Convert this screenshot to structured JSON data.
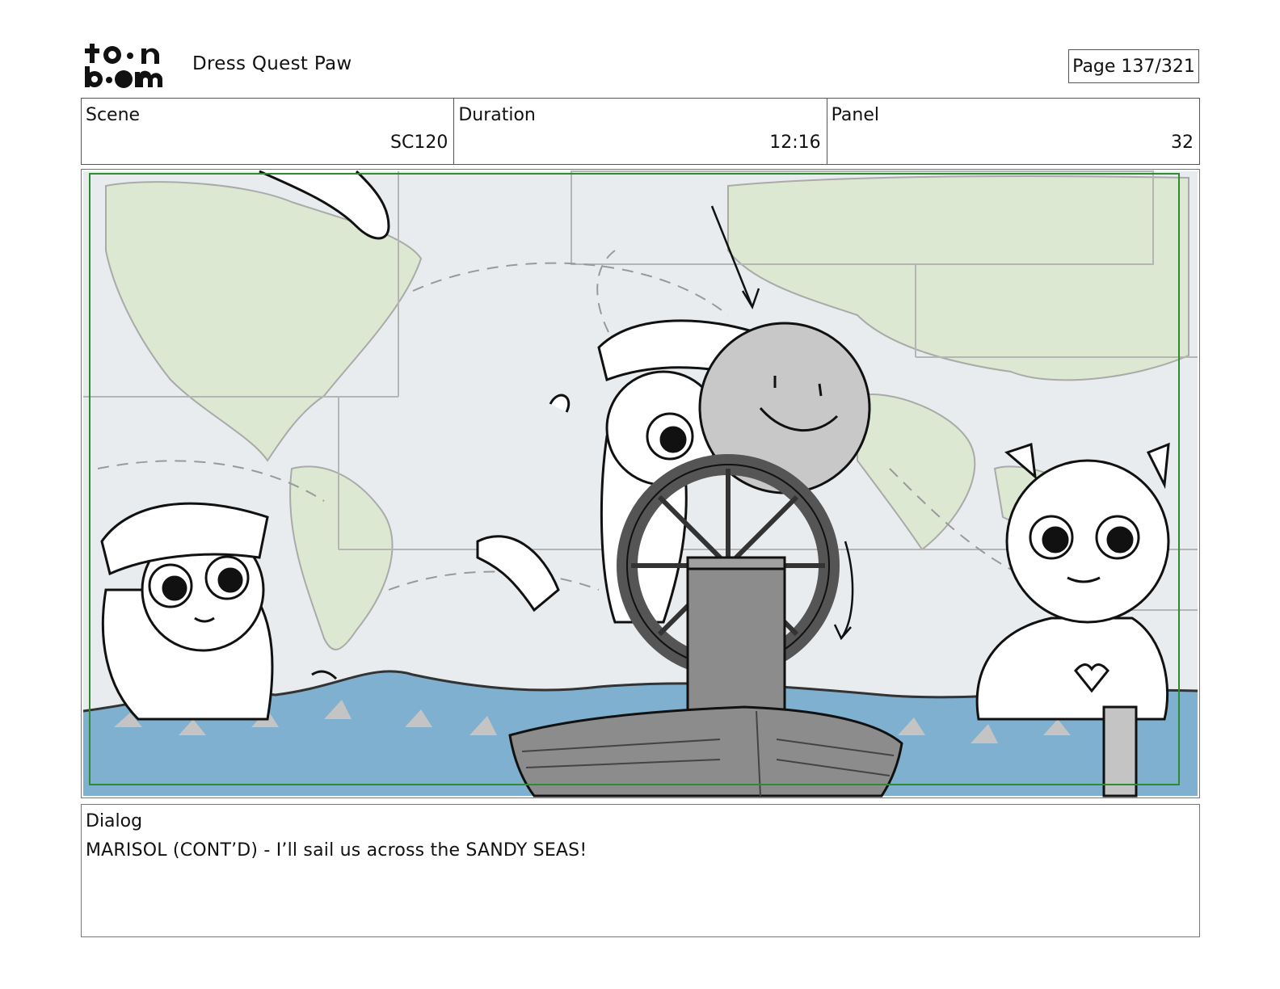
{
  "header": {
    "logo_text": "toon boom",
    "project_title": "Dress Quest Paw",
    "page_indicator": "Page 137/321"
  },
  "info": {
    "scene_label": "Scene",
    "scene_value": "SC120",
    "duration_label": "Duration",
    "duration_value": "12:16",
    "panel_label": "Panel",
    "panel_value": "32"
  },
  "panel_image": {
    "colors": {
      "map_background": "#e9ecef",
      "land": "#dce8d2",
      "water": "#7fb0cf",
      "safe_frame": "#2e8b2e",
      "boat": "#8c8c8c",
      "sun": "#c8c8c8"
    }
  },
  "dialog": {
    "label": "Dialog",
    "text": "MARISOL (CONT’D) - I’ll sail us across the SANDY SEAS!"
  }
}
